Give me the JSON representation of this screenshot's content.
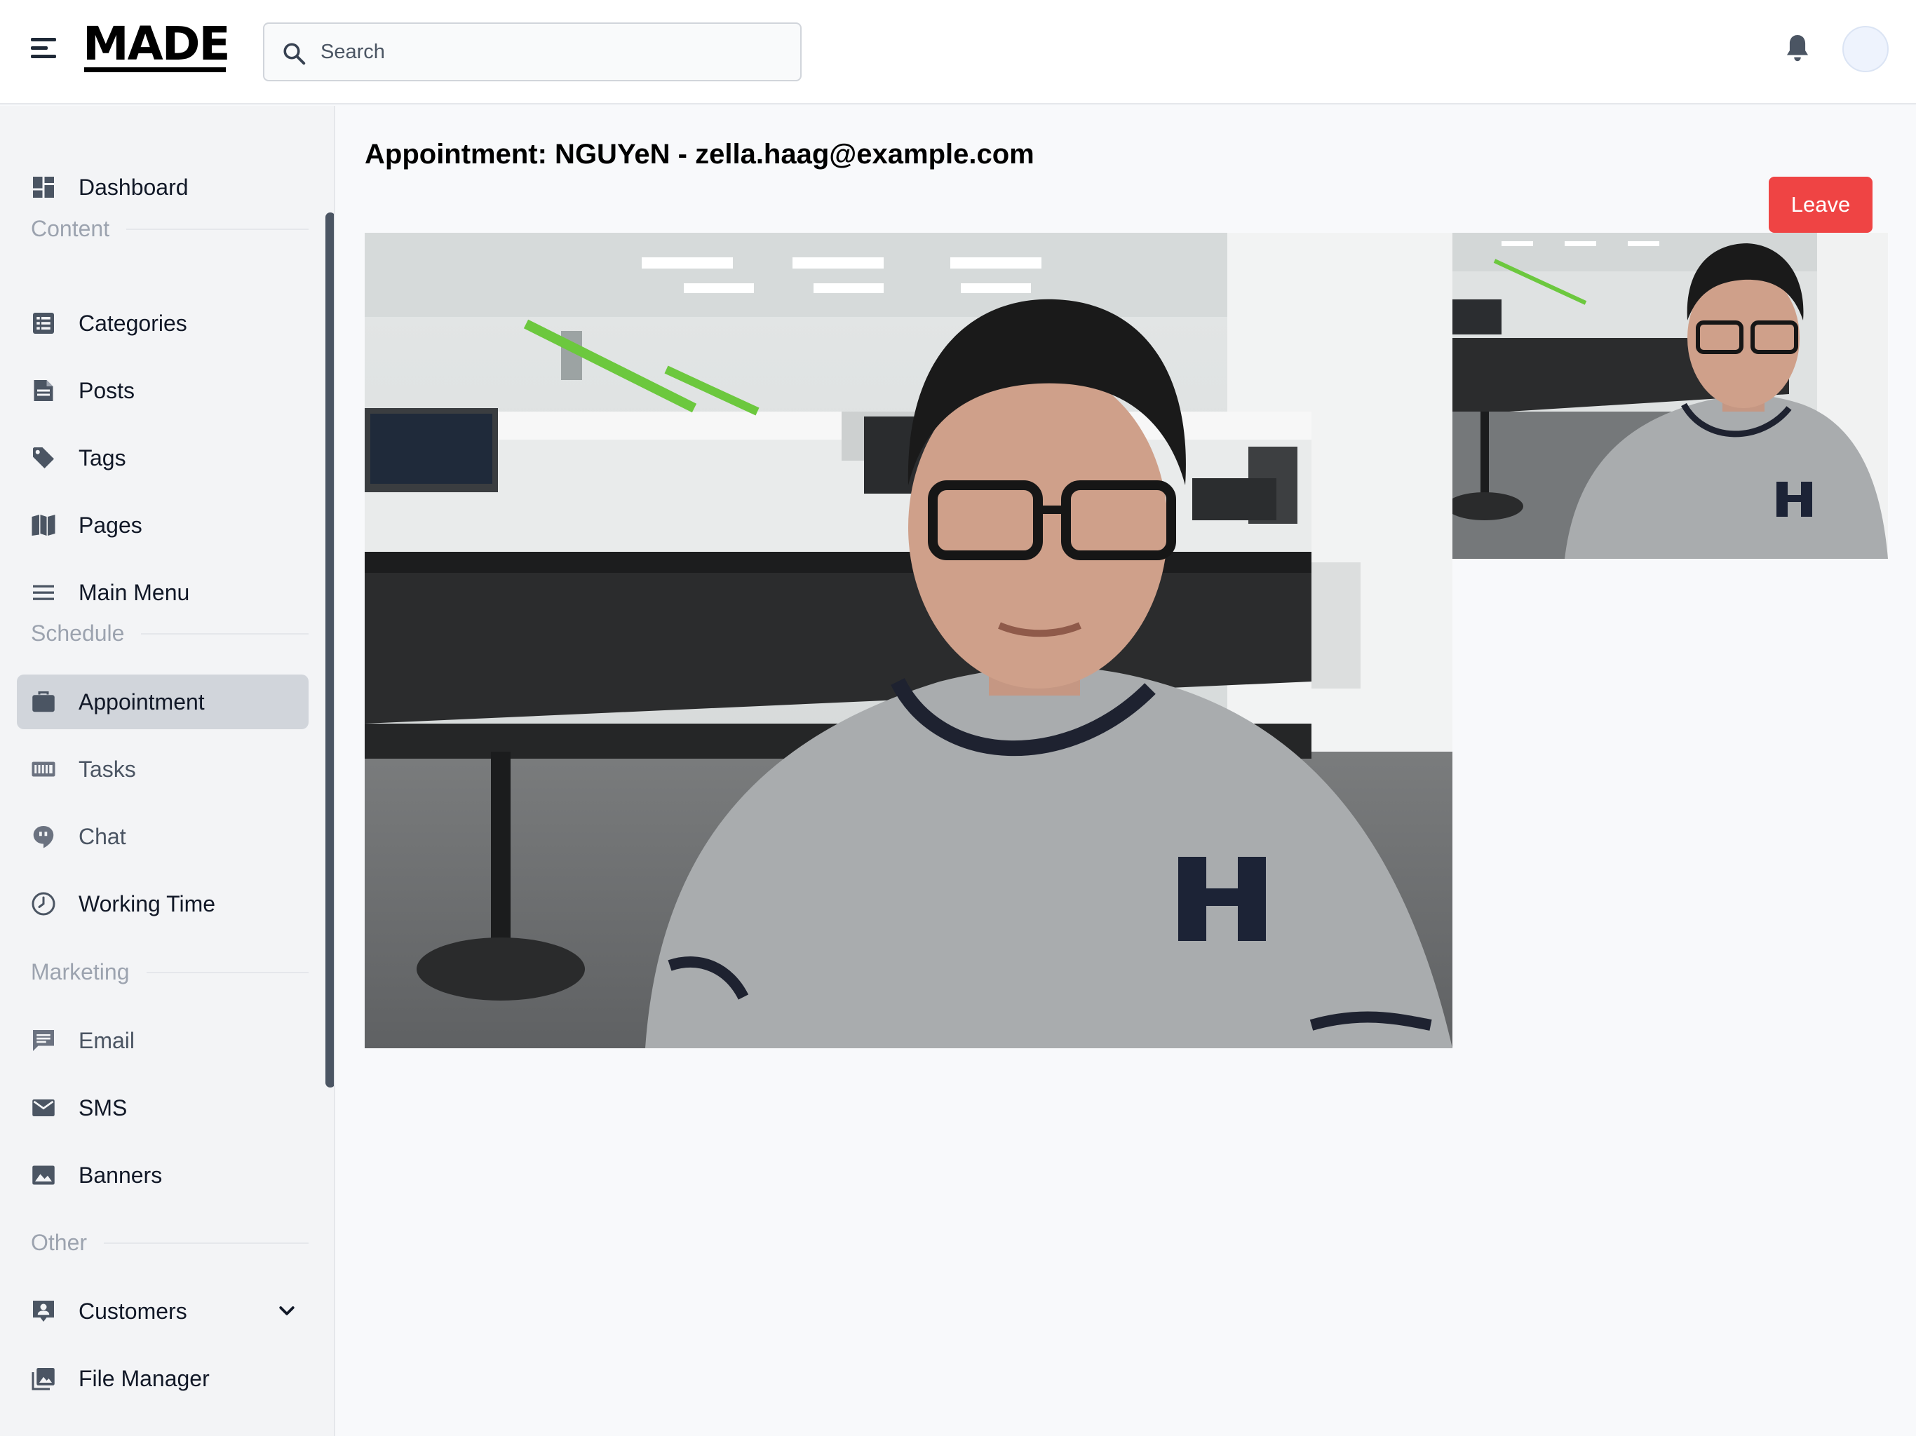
{
  "header": {
    "logo_text": "MADE",
    "search": {
      "placeholder": "Search",
      "value": ""
    }
  },
  "sidebar": {
    "top_items": [
      {
        "label": "Dashboard",
        "icon": "dashboard-icon"
      }
    ],
    "sections": [
      {
        "title": "Content",
        "items": [
          {
            "label": "Categories",
            "icon": "list-icon"
          },
          {
            "label": "Posts",
            "icon": "document-icon"
          },
          {
            "label": "Tags",
            "icon": "tag-icon"
          },
          {
            "label": "Pages",
            "icon": "book-icon"
          },
          {
            "label": "Main Menu",
            "icon": "menu-icon"
          }
        ]
      },
      {
        "title": "Schedule",
        "items": [
          {
            "label": "Appointment",
            "icon": "briefcase-icon",
            "active": true
          },
          {
            "label": "Tasks",
            "icon": "keyboard-icon"
          },
          {
            "label": "Chat",
            "icon": "chat-icon"
          },
          {
            "label": "Working Time",
            "icon": "clock-icon"
          }
        ]
      },
      {
        "title": "Marketing",
        "items": [
          {
            "label": "Email",
            "icon": "message-icon"
          },
          {
            "label": "SMS",
            "icon": "envelope-icon"
          },
          {
            "label": "Banners",
            "icon": "image-icon"
          }
        ]
      },
      {
        "title": "Other",
        "items": [
          {
            "label": "Customers",
            "icon": "contact-icon",
            "expandable": true
          },
          {
            "label": "File Manager",
            "icon": "photo-library-icon"
          }
        ]
      }
    ]
  },
  "main": {
    "title": "Appointment: NGUYeN - zella.haag@example.com",
    "leave_label": "Leave"
  },
  "colors": {
    "leave": "#ef4444",
    "active_item": "#d1d5db",
    "sidebar_bg": "#f3f4f6"
  }
}
